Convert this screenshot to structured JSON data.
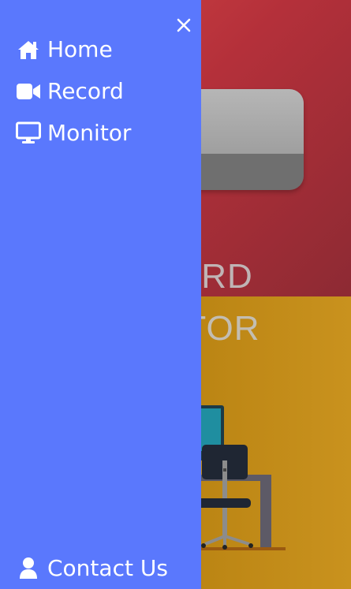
{
  "background": {
    "record_label": "RECORD",
    "monitor_label": "MONITOR",
    "colors": {
      "record_panel": "#c93d43",
      "monitor_panel": "#c08c1a",
      "drawer": "#5a78fd"
    }
  },
  "drawer": {
    "close_icon": "close-icon",
    "items": [
      {
        "label": "Home",
        "icon": "home-icon"
      },
      {
        "label": "Record",
        "icon": "video-camera-icon"
      },
      {
        "label": "Monitor",
        "icon": "desktop-monitor-icon"
      }
    ],
    "footer": {
      "label": "Contact Us",
      "icon": "user-icon"
    }
  }
}
